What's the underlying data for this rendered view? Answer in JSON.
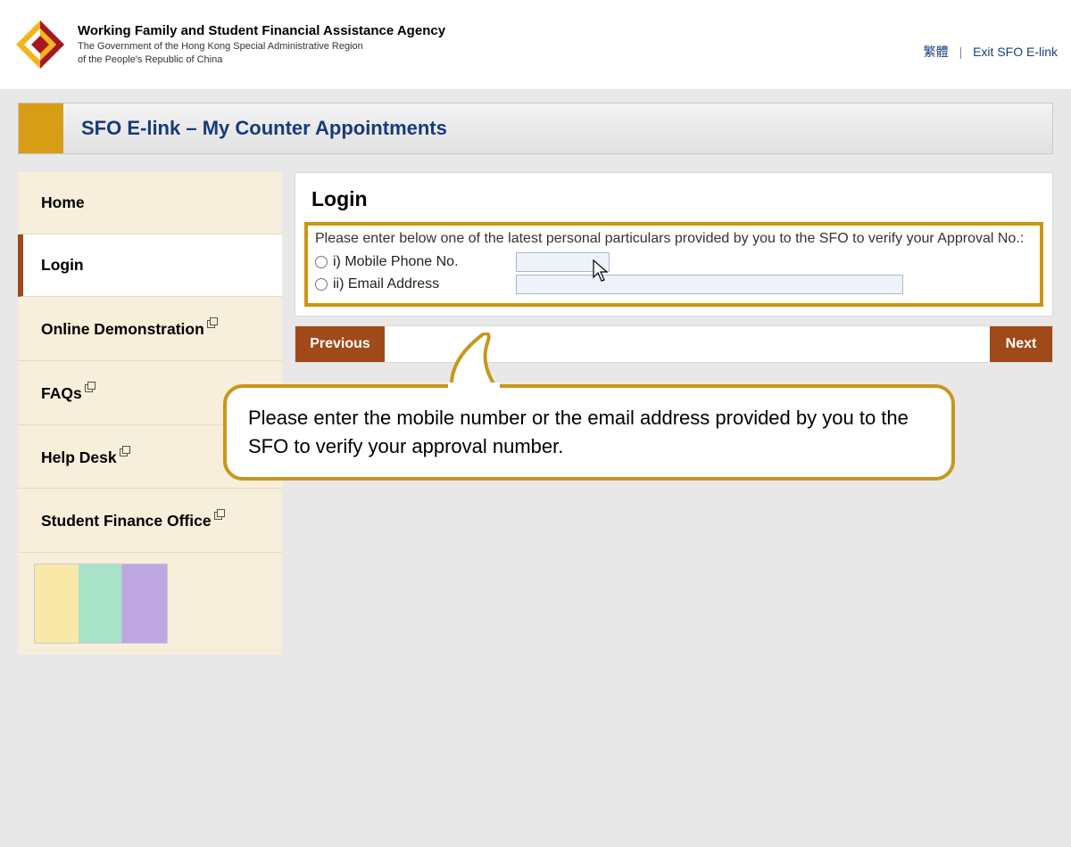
{
  "header": {
    "agency_title": "Working Family and Student Financial Assistance Agency",
    "agency_sub1": "The Government of the Hong Kong Special Administrative Region",
    "agency_sub2": "of the People's Republic of China",
    "lang_link": "繁體",
    "exit_link": "Exit SFO E-link"
  },
  "page": {
    "title": "SFO E-link – My Counter Appointments"
  },
  "sidebar": {
    "items": [
      {
        "label": "Home",
        "ext": false,
        "active": false
      },
      {
        "label": "Login",
        "ext": false,
        "active": true
      },
      {
        "label": "Online Demonstration",
        "ext": true,
        "active": false
      },
      {
        "label": "FAQs",
        "ext": true,
        "active": false
      },
      {
        "label": "Help Desk",
        "ext": true,
        "active": false
      },
      {
        "label": "Student Finance Office",
        "ext": true,
        "active": false
      }
    ]
  },
  "login": {
    "heading": "Login",
    "instruction": "Please enter below one of the latest personal particulars provided by you to the SFO to verify your Approval No.:",
    "option1": "i) Mobile Phone No.",
    "option2": "ii) Email Address"
  },
  "buttons": {
    "previous": "Previous",
    "next": "Next"
  },
  "callout": {
    "text": "Please enter the mobile number or the email address provided by you to the SFO to verify your approval number."
  }
}
